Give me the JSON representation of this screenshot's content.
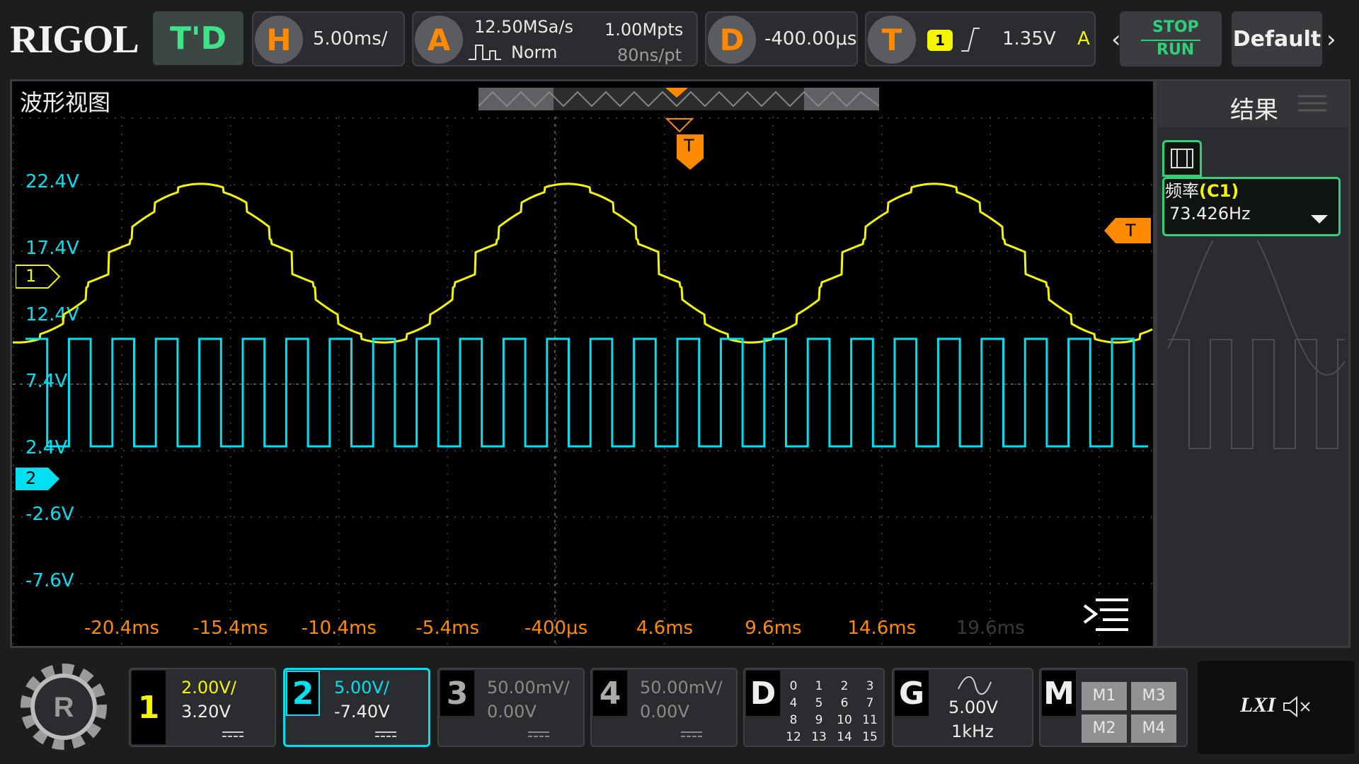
{
  "header": {
    "logo": "RIGOL",
    "mode_label": "T'D",
    "horizontal": {
      "key": "H",
      "scale": "5.00ms/"
    },
    "acquire": {
      "key": "A",
      "sample_rate": "12.50MSa/s",
      "depth": "1.00Mpts",
      "mode": "Norm",
      "resolution": "80ns/pt"
    },
    "delay": {
      "key": "D",
      "value": "-400.00μs"
    },
    "trigger": {
      "key": "T",
      "source": "1",
      "level": "1.35V",
      "mode": "A"
    },
    "stop_label": "STOP",
    "run_label": "RUN",
    "default_label": "Default"
  },
  "waveform_view": {
    "title": "波形视图",
    "y_labels": [
      "22.4V",
      "17.4V",
      "12.4V",
      "7.4V",
      "2.4V",
      "-2.6V",
      "-7.6V"
    ],
    "x_labels": [
      "-20.4ms",
      "-15.4ms",
      "-10.4ms",
      "-5.4ms",
      "-400μs",
      "4.6ms",
      "9.6ms",
      "14.6ms",
      "19.6ms"
    ],
    "ch1_marker": "1",
    "ch2_marker": "2",
    "trigger_marker": "T"
  },
  "results": {
    "title": "结果",
    "measurement_label": "频率",
    "measurement_source": "(C1)",
    "measurement_value": "73.426Hz"
  },
  "channels": [
    {
      "num": "1",
      "scale": "2.00V/",
      "offset": "3.20V",
      "color": "#f5f500"
    },
    {
      "num": "2",
      "scale": "5.00V/",
      "offset": "-7.40V",
      "color": "#00e0f0"
    },
    {
      "num": "3",
      "scale": "50.00mV/",
      "offset": "0.00V",
      "color": "#9a9a9a"
    },
    {
      "num": "4",
      "scale": "50.00mV/",
      "offset": "0.00V",
      "color": "#9a9a9a"
    }
  ],
  "digital": {
    "key": "D",
    "bits": [
      "0",
      "1",
      "2",
      "3",
      "4",
      "5",
      "6",
      "7",
      "8",
      "9",
      "10",
      "11",
      "12",
      "13",
      "14",
      "15"
    ]
  },
  "generator": {
    "key": "G",
    "amplitude": "5.00V",
    "frequency": "1kHz"
  },
  "math": {
    "key": "M",
    "items": [
      "M1",
      "M3",
      "M2",
      "M4"
    ]
  },
  "status": {
    "lxi": "LXI"
  },
  "colors": {
    "ch1": "#f5f500",
    "ch2": "#00e0f0",
    "accent": "#ff8a00",
    "active": "#2fd07a"
  }
}
